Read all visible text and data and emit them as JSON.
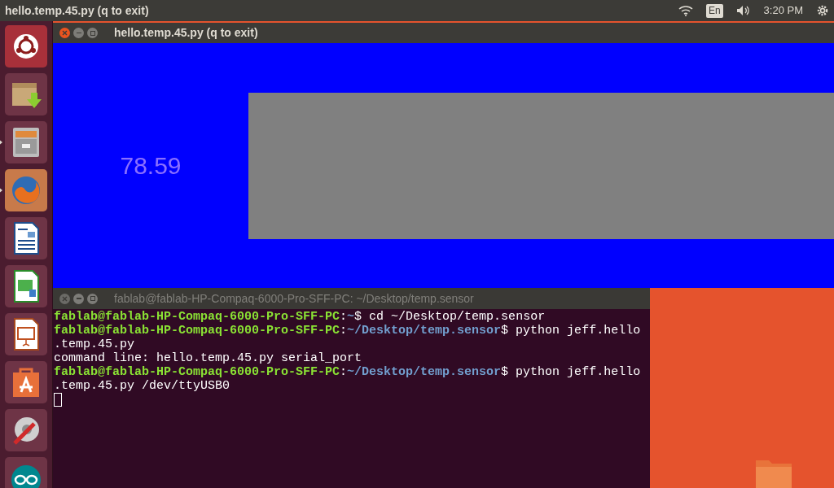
{
  "top_panel": {
    "title": "hello.temp.45.py (q to exit)",
    "keyboard": "En",
    "clock": "3:20 PM"
  },
  "launcher": {
    "items": [
      {
        "kind": "ubuntu",
        "running": false
      },
      {
        "kind": "package",
        "running": false
      },
      {
        "kind": "files",
        "running": true
      },
      {
        "kind": "browser",
        "running": true
      },
      {
        "kind": "writer",
        "running": false
      },
      {
        "kind": "calc",
        "running": false
      },
      {
        "kind": "impress",
        "running": false
      },
      {
        "kind": "store",
        "running": false
      },
      {
        "kind": "settings",
        "running": false
      },
      {
        "kind": "arduino",
        "running": false
      }
    ]
  },
  "app_window": {
    "title": "hello.temp.45.py (q to exit)",
    "focused": true,
    "reading": "78.59"
  },
  "terminal": {
    "title": "fablab@fablab-HP-Compaq-6000-Pro-SFF-PC: ~/Desktop/temp.sensor",
    "focused": false,
    "lines": [
      {
        "kind": "prompt",
        "user": "fablab@fablab-HP-Compaq-6000-Pro-SFF-PC",
        "separator": ":",
        "path": "~",
        "command": "$ cd ~/Desktop/temp.sensor"
      },
      {
        "kind": "prompt",
        "user": "fablab@fablab-HP-Compaq-6000-Pro-SFF-PC",
        "separator": ":",
        "path": "~/Desktop/temp.sensor",
        "command": "$ python jeff.hello"
      },
      {
        "kind": "output",
        "text": ".temp.45.py"
      },
      {
        "kind": "output",
        "text": "command line: hello.temp.45.py serial_port"
      },
      {
        "kind": "prompt",
        "user": "fablab@fablab-HP-Compaq-6000-Pro-SFF-PC",
        "separator": ":",
        "path": "~/Desktop/temp.sensor",
        "command": "$ python jeff.hello"
      },
      {
        "kind": "output",
        "text": ".temp.45.py /dev/ttyUSB0"
      },
      {
        "kind": "cursor"
      }
    ]
  }
}
